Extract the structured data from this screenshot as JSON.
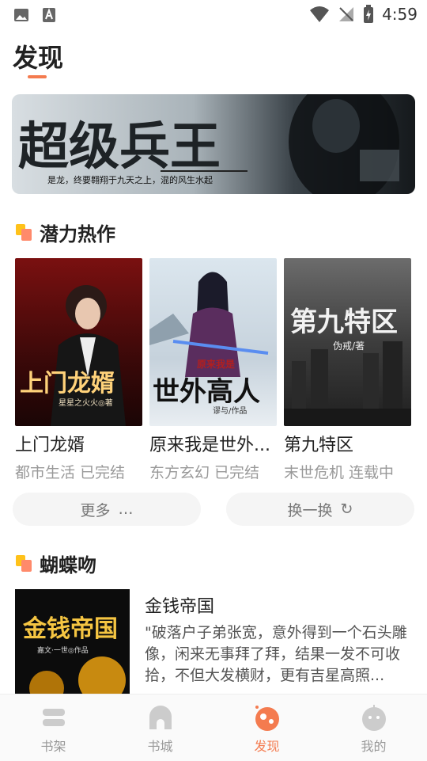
{
  "status": {
    "time": "4:59"
  },
  "page": {
    "title": "发现"
  },
  "banner": {
    "title": "超级兵王",
    "tagline": "是龙，终要翱翔于九天之上，混的风生水起"
  },
  "section1": {
    "title": "潜力热作",
    "books": [
      {
        "title": "上门龙婿",
        "meta": "都市生活 已完结",
        "cover_title": "上门龙婿",
        "cover_author": "星星之火火◎著"
      },
      {
        "title": "原来我是世外...",
        "meta": "东方玄幻 已完结",
        "cover_title": "世外高人",
        "cover_top": "原来我是",
        "cover_author": "谬与/作品"
      },
      {
        "title": "第九特区",
        "meta": "末世危机 连载中",
        "cover_title": "第九特区",
        "cover_author": "伪戒/著"
      }
    ],
    "more_label": "更多",
    "more_icon": "…",
    "refresh_label": "换一换",
    "refresh_icon": "↻"
  },
  "section2": {
    "title": "蝴蝶吻",
    "feature": {
      "title": "金钱帝国",
      "desc": "\"破落户子弟张宽，意外得到一个石头雕像，闲来无事拜了拜，结果一发不可收拾，不但大发横财，更有吉星高照...",
      "cover_title": "金钱帝国",
      "cover_author": "嘉文·一世◎作品"
    }
  },
  "nav": [
    {
      "label": "书架"
    },
    {
      "label": "书城"
    },
    {
      "label": "发现"
    },
    {
      "label": "我的"
    }
  ],
  "colors": {
    "accent": "#f47b4f",
    "muted": "#999999"
  }
}
